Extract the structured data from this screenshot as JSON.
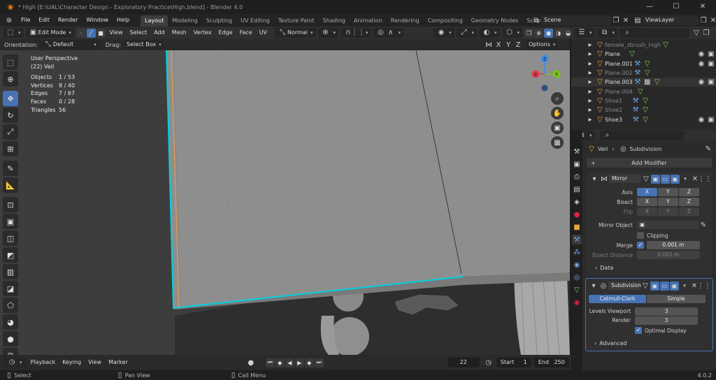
{
  "window": {
    "title": "* High [E:\\UAL\\Character Design - Exploratory Practice\\High.blend] - Blender 4.0",
    "min_glyph": "—",
    "max_glyph": "☐",
    "close_glyph": "✕"
  },
  "menu": [
    "File",
    "Edit",
    "Render",
    "Window",
    "Help"
  ],
  "workspaces": [
    "Layout",
    "Modeling",
    "Sculpting",
    "UV Editing",
    "Texture Paint",
    "Shading",
    "Animation",
    "Rendering",
    "Compositing",
    "Geometry Nodes",
    "Scripting"
  ],
  "scene": {
    "name": "Scene",
    "view_layer": "ViewLayer"
  },
  "viewport_header": {
    "mode": "Edit Mode",
    "menus": [
      "View",
      "Select",
      "Add",
      "Mesh",
      "Vertex",
      "Edge",
      "Face",
      "UV"
    ],
    "transform": "Normal",
    "options_label": "Options",
    "axis_x": "X",
    "axis_y": "Y",
    "axis_z": "Z"
  },
  "tool_settings": {
    "orientation_label": "Orientation:",
    "orientation_value": "Default",
    "drag_label": "Drag:",
    "drag_value": "Select Box"
  },
  "stats": {
    "perspective": "User Perspective",
    "object": "(22) Veil",
    "rows": [
      {
        "label": "Objects",
        "value": "1 / 53"
      },
      {
        "label": "Vertices",
        "value": "8 / 40"
      },
      {
        "label": "Edges",
        "value": "7 / 67"
      },
      {
        "label": "Faces",
        "value": "0 / 28"
      },
      {
        "label": "Triangles",
        "value": "56"
      }
    ]
  },
  "gizmo": {
    "x": "X",
    "y": "Y",
    "z": "Z"
  },
  "timeline": {
    "menus": [
      "Playback",
      "Keying",
      "View",
      "Marker"
    ],
    "current_frame": "22",
    "start_label": "Start",
    "start": "1",
    "end_label": "End",
    "end": "250"
  },
  "statusbar": {
    "select": "Select",
    "pan": "Pan View",
    "call_menu": "Call Menu",
    "version": "4.0.2"
  },
  "outliner": {
    "items": [
      {
        "name": "female_zbrush_high",
        "dim": true
      },
      {
        "name": "Plane",
        "dim": false
      },
      {
        "name": "Plane.001",
        "dim": false
      },
      {
        "name": "Plane.002",
        "dim": true
      },
      {
        "name": "Plane.003",
        "dim": false
      },
      {
        "name": "Plane.004",
        "dim": true
      },
      {
        "name": "Shoe1",
        "dim": true
      },
      {
        "name": "Shoe2",
        "dim": true
      },
      {
        "name": "Shoe3",
        "dim": false
      }
    ]
  },
  "properties": {
    "breadcrumb_object": "Veil",
    "breadcrumb_modifier": "Subdivision",
    "add_modifier": "Add Modifier",
    "mirror": {
      "name": "Mirror",
      "axis_label": "Axis",
      "bisect_label": "Bisect",
      "flip_label": "Flip",
      "x": "X",
      "y": "Y",
      "z": "Z",
      "mirror_object_label": "Mirror Object",
      "clipping_label": "Clipping",
      "merge_label": "Merge",
      "merge_value": "0.001 m",
      "bisect_distance_label": "Bisect Distance",
      "bisect_distance_value": "0.001 m",
      "data_label": "Data"
    },
    "subdivision": {
      "name": "Subdivision",
      "catmull": "Catmull-Clark",
      "simple": "Simple",
      "levels_viewport_label": "Levels Viewport",
      "levels_viewport": "3",
      "render_label": "Render",
      "render": "3",
      "optimal_label": "Optimal Display",
      "advanced_label": "Advanced"
    }
  },
  "colors": {
    "accent": "#4772b3",
    "selection_outline": "#00d1e0",
    "edge_orange": "#f0a040",
    "axis_x": "#e23a4e",
    "axis_y": "#79c31f",
    "axis_z": "#3f8ee8"
  }
}
